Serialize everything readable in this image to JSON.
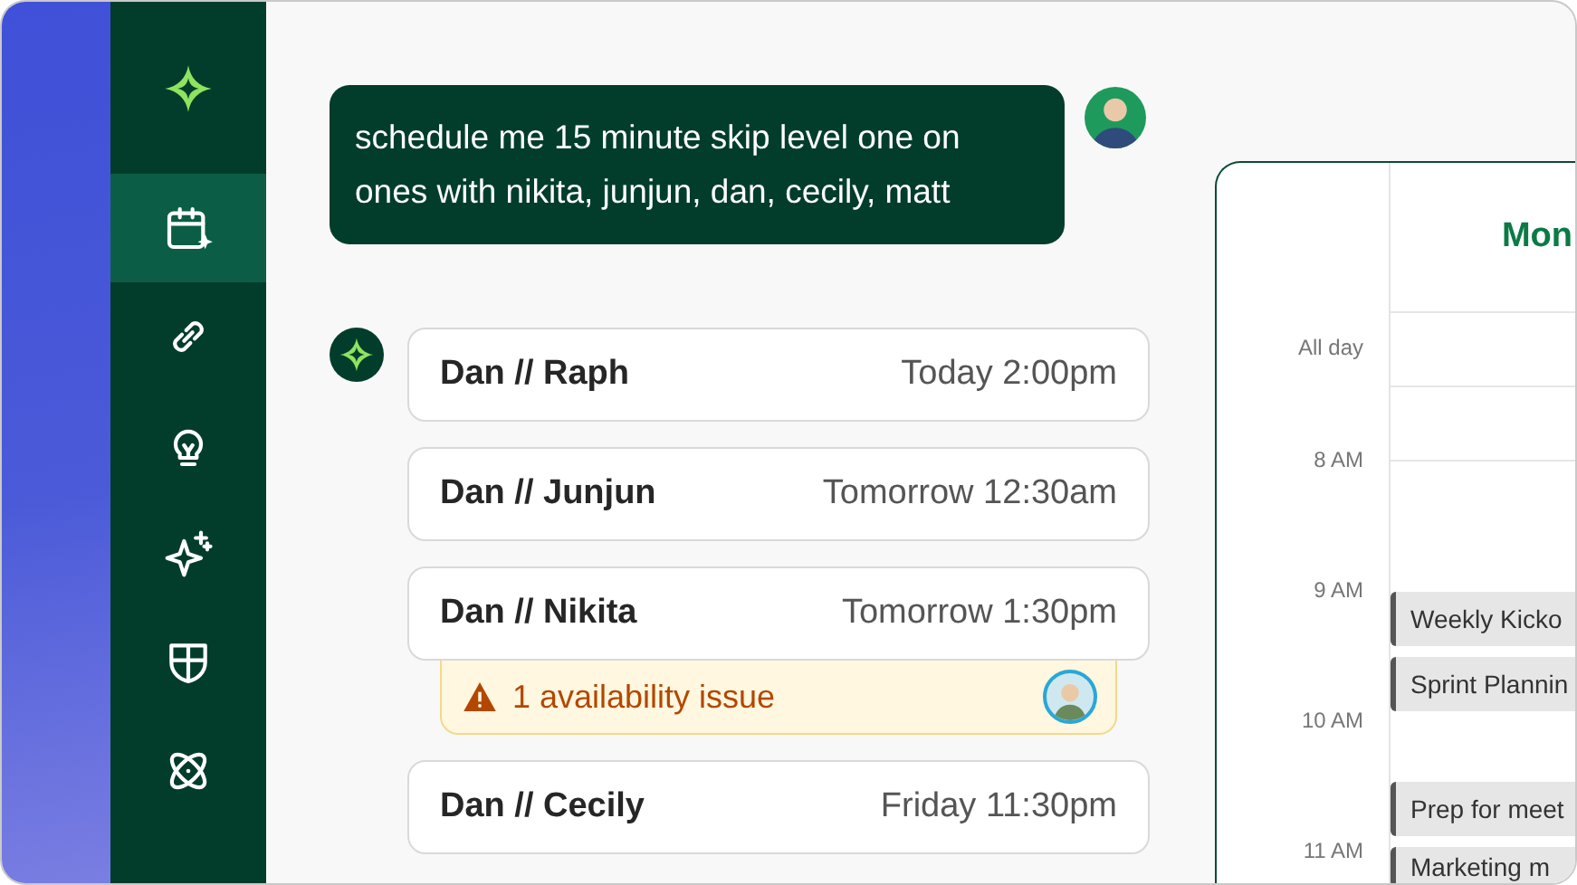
{
  "sidebar": {
    "items": [
      {
        "kind": "calendar",
        "selected": true
      },
      {
        "kind": "link",
        "selected": false
      },
      {
        "kind": "bulb",
        "selected": false
      },
      {
        "kind": "sparkles",
        "selected": false
      },
      {
        "kind": "shield",
        "selected": false
      },
      {
        "kind": "atom",
        "selected": false
      }
    ]
  },
  "chat": {
    "user_message": "schedule me 15 minute skip level one on ones with nikita, junjun, dan, cecily, matt",
    "meetings": [
      {
        "title": "Dan // Raph",
        "time": "Today 2:00pm"
      },
      {
        "title": "Dan // Junjun",
        "time": "Tomorrow 12:30am"
      },
      {
        "title": "Dan // Nikita",
        "time": "Tomorrow 1:30pm",
        "warning": "1 availability issue"
      },
      {
        "title": "Dan // Cecily",
        "time": "Friday 11:30pm"
      }
    ]
  },
  "calendar": {
    "day": "Mon",
    "all_day_label": "All day",
    "hours": [
      "8 AM",
      "9 AM",
      "10 AM",
      "11 AM"
    ],
    "events": [
      {
        "title": "Weekly Kicko"
      },
      {
        "title": "Sprint Plannin"
      },
      {
        "title": "Prep for meet"
      },
      {
        "title": "Marketing m"
      }
    ]
  }
}
